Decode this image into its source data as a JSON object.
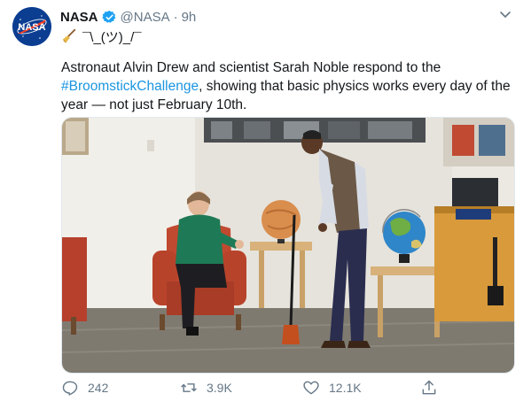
{
  "tweet": {
    "author_name": "NASA",
    "handle": "@NASA",
    "separator": "·",
    "time": "9h",
    "shrug": "¯\\_(ツ)_/¯",
    "text_before": "Astronaut Alvin Drew and scientist Sarah Noble respond to the ",
    "hashtag": "#BroomstickChallenge",
    "text_after": ", showing that basic physics works every day of the year — not just February 10th."
  },
  "actions": {
    "replies": "242",
    "retweets": "3.9K",
    "likes": "12.1K"
  },
  "colors": {
    "accent": "#1b95e0",
    "verified": "#1da1f2",
    "muted": "#657786",
    "nasa_blue": "#0b3d91",
    "nasa_red": "#fc3d21"
  },
  "icons": [
    "nasa-logo-icon",
    "verified-badge-icon",
    "chevron-down-icon",
    "broom-icon",
    "reply-icon",
    "retweet-icon",
    "like-icon",
    "share-icon"
  ]
}
